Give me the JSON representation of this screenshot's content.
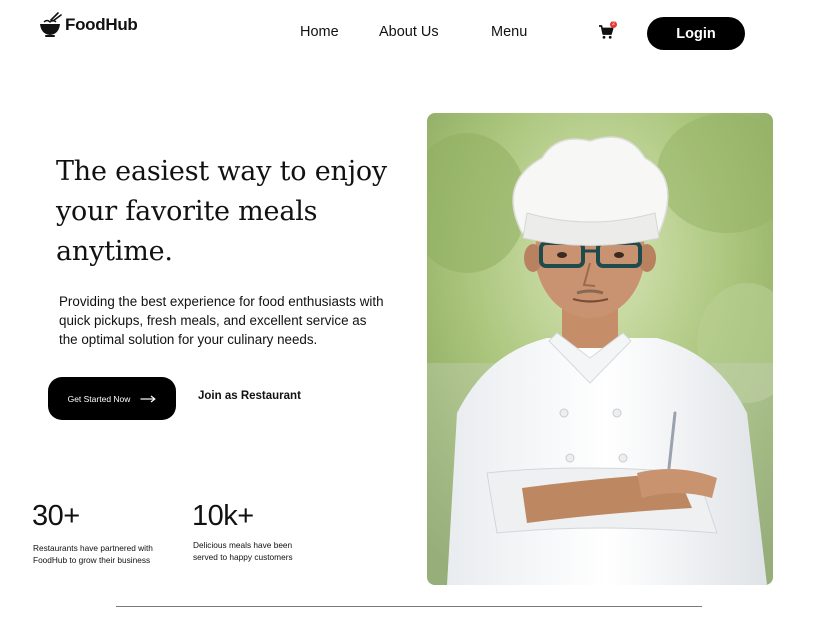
{
  "header": {
    "brand": "FoodHub",
    "nav": [
      "Home",
      "About Us",
      "Menu"
    ],
    "cart_count": "2",
    "login_label": "Login"
  },
  "hero": {
    "title_lines": [
      "The easiest way to enjoy",
      "your favorite meals",
      "anytime."
    ],
    "description_lines": [
      "Providing the best experience for food enthusiasts with",
      "quick pickups, fresh meals, and excellent service as",
      "the optimal solution for your culinary needs."
    ],
    "cta_label": "Get Started Now",
    "secondary_label": "Join as Restaurant"
  },
  "stats": [
    {
      "value": "30+",
      "lines": [
        "Restaurants have partnered with",
        "FoodHub to grow their business"
      ]
    },
    {
      "value": "10k+",
      "lines": [
        "Delicious meals have been",
        "served to happy customers"
      ]
    }
  ],
  "colors": {
    "primary": "#000000",
    "background": "#ffffff",
    "badge": "#e53935",
    "divider": "#7a7a7a"
  },
  "icons": {
    "logo": "noodle-bowl-icon",
    "cart": "shopping-cart-icon",
    "cta": "arrow-right-icon"
  }
}
